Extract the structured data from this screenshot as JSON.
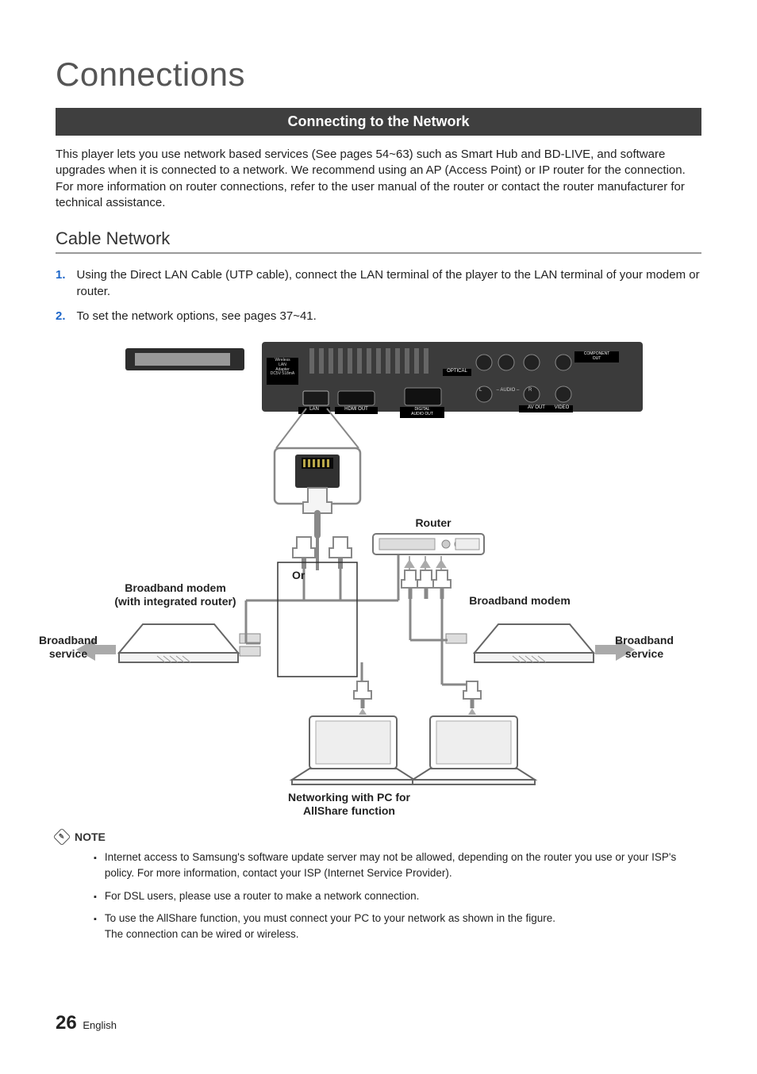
{
  "title": "Connections",
  "banner": "Connecting to the Network",
  "intro": "This player lets you use network based services (See pages 54~63) such as Smart Hub and BD-LIVE, and software upgrades when it is connected to a network. We recommend using an AP (Access Point) or IP router for the connection. For more information on router connections, refer to the user manual of the router or contact the router manufacturer for technical assistance.",
  "subhead": "Cable Network",
  "steps": [
    {
      "num": "1.",
      "text": "Using the Direct LAN Cable (UTP cable), connect the LAN terminal of the player to the LAN terminal of your modem or router."
    },
    {
      "num": "2.",
      "text": "To set the network options, see pages 37~41."
    }
  ],
  "diagram": {
    "rear_panel": {
      "wlan_adapter_label": "Wireless\nLAN\nAdapter\nDC5V 518mA",
      "lan": "LAN",
      "hdmi": "HDMI OUT",
      "optical": "OPTICAL",
      "digital_audio": "DIGITAL\nAUDIO OUT",
      "audio_lr": "– AUDIO –",
      "av_out": "AV OUT",
      "component": "COMPONENT\nOUT",
      "video": "VIDEO",
      "l": "L",
      "r": "R"
    },
    "router": "Router",
    "or": "Or",
    "modem_integrated": "Broadband modem\n(with integrated router)",
    "modem_plain": "Broadband modem",
    "broadband_service": "Broadband\nservice",
    "pc_caption": "Networking with PC for\nAllShare function"
  },
  "note_heading": "NOTE",
  "notes": [
    "Internet access to Samsung's software update server may not be allowed, depending on the router you use or your ISP's policy. For more information, contact your ISP (Internet Service Provider).",
    "For DSL users, please use a router to make a network connection.",
    "To use the AllShare function, you must connect your PC to your network as shown in the figure.\nThe connection can be wired or wireless."
  ],
  "footer": {
    "page": "26",
    "lang": "English"
  }
}
